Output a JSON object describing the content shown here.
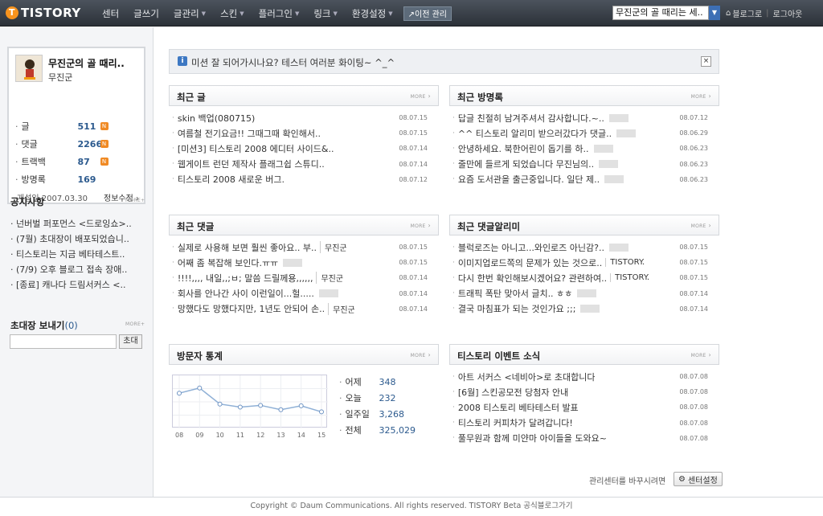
{
  "topbar": {
    "logo_text": "TISTORY",
    "logo_mark": "T",
    "menu": [
      {
        "label": "센터",
        "caret": ""
      },
      {
        "label": "글쓰기",
        "caret": ""
      },
      {
        "label": "글관리",
        "caret": "▼"
      },
      {
        "label": "스킨",
        "caret": "▼"
      },
      {
        "label": "플러그인",
        "caret": "▼"
      },
      {
        "label": "링크",
        "caret": "▼"
      },
      {
        "label": "환경설정",
        "caret": "▼"
      }
    ],
    "prev_admin": "↗이전 관리",
    "blog_select_value": "무진군의 골 때리는 세..",
    "blog_link": "블로그로",
    "logout": "로그아웃"
  },
  "sidebar": {
    "blog_name": "무진군의 골 때리..",
    "owner": "무진군",
    "stats": [
      {
        "label": "글",
        "value": "511",
        "new": "N"
      },
      {
        "label": "댓글",
        "value": "2266",
        "new": "N"
      },
      {
        "label": "트랙백",
        "value": "87",
        "new": "N"
      },
      {
        "label": "방명록",
        "value": "169",
        "new": ""
      }
    ],
    "opened": "개설일 2007.03.30",
    "edit_info": "정보수정 ›",
    "notice_title": "공지사항",
    "more": "MORE+",
    "notices": [
      "넌버벌 퍼포먼스 <드로잉쇼>..",
      "(7월) 초대장이 배포되었습니..",
      "티스토리는 지금 베타테스트..",
      "(7/9) 오후 블로그 접속 장애..",
      "[종료] 캐나다 드림서커스 <.."
    ],
    "invite_title": "초대장 보내기",
    "invite_count": "(0)",
    "invite_button": "초대"
  },
  "notice_bar": {
    "text": "미션 잘 되어가시나요? 테스터 여러분 화이팅~ ^_^",
    "close": "×"
  },
  "panels": {
    "recent_posts": {
      "title": "최근 글",
      "more": "MORE",
      "rows": [
        {
          "text": "skin 백업(080715)",
          "date": "08.07.15"
        },
        {
          "text": "여름철 전기요금!! 그때그때 확인해서..",
          "date": "08.07.15"
        },
        {
          "text": "[미션3] 티스토리 2008 에디터 사이드&..",
          "date": "08.07.14"
        },
        {
          "text": "웹게이트 런던 제작사 플래그쉽 스튜디..",
          "date": "08.07.14"
        },
        {
          "text": "티스토리 2008 새로운 버그.",
          "date": "08.07.12"
        }
      ]
    },
    "recent_guestbook": {
      "title": "최근 방명록",
      "more": "MORE",
      "rows": [
        {
          "text": "답글 친절히 남겨주셔서 감사합니다.~..",
          "date": "08.07.12"
        },
        {
          "text": "^^ 티스토리 알리미 받으러갔다가 댓글..",
          "date": "08.06.29"
        },
        {
          "text": "안녕하세요. 북한어린이 돕기를 하..",
          "date": "08.06.23"
        },
        {
          "text": "줄만에 들르게 되었습니다 무진님의..",
          "date": "08.06.23"
        },
        {
          "text": "요즘 도서관을 출근중입니다. 일단 제..",
          "date": "08.06.23"
        }
      ]
    },
    "recent_comments": {
      "title": "최근 댓글",
      "more": "MORE",
      "rows": [
        {
          "text": "실제로 사용해 보면 훨씬 좋아요.. 부..",
          "author": "무진군",
          "date": "08.07.15"
        },
        {
          "text": "어째 좀 복잡해 보인다.ㅠㅠ",
          "author": "",
          "date": "08.07.15"
        },
        {
          "text": "!!!!,,,, 내일,,;ㅂ; 말씀 드릴께용,,,,,,",
          "author": "무진군",
          "date": "08.07.14"
        },
        {
          "text": "회사를 안나간 사이 이런일이...헐.....",
          "author": "",
          "date": "08.07.14"
        },
        {
          "text": "망했다도 망했다지만, 1년도 안되어 손..",
          "author": "무진군",
          "date": "08.07.14"
        }
      ]
    },
    "comment_alarm": {
      "title": "최근 댓글알리미",
      "more": "MORE",
      "rows": [
        {
          "text": "블럭로즈는 아니고...와인로즈 아닌감?..",
          "author": "",
          "date": "08.07.15"
        },
        {
          "text": "이미지업로드쪽의 문제가 있는 것으로..",
          "author": "TISTORY.",
          "date": "08.07.15"
        },
        {
          "text": "다시 한번 확인해보시겠어요? 관련하여..",
          "author": "TISTORY.",
          "date": "08.07.15"
        },
        {
          "text": "트래픽 폭탄 맞아서 글치.. ㅎㅎ",
          "author": "",
          "date": "08.07.14"
        },
        {
          "text": "결국 마침표가 되는 것인가요 ;;;",
          "author": "",
          "date": "08.07.14"
        }
      ]
    },
    "visitor_stats": {
      "title": "방문자 통계",
      "more": "MORE",
      "days": [
        "08",
        "09",
        "10",
        "11",
        "12",
        "13",
        "14",
        "15"
      ],
      "graph": [
        0.7,
        0.82,
        0.45,
        0.38,
        0.42,
        0.32,
        0.41,
        0.27
      ],
      "stats": [
        {
          "label": "어제",
          "value": "348"
        },
        {
          "label": "오늘",
          "value": "232"
        },
        {
          "label": "일주일",
          "value": "3,268"
        },
        {
          "label": "전체",
          "value": "325,029"
        }
      ]
    },
    "tistory_events": {
      "title": "티스토리 이벤트 소식",
      "more": "MORE",
      "rows": [
        {
          "text": "아트 서커스 <네비아>로 초대합니다",
          "date": "08.07.08"
        },
        {
          "text": "[6월] 스킨공모전 당첨자 안내",
          "date": "08.07.08"
        },
        {
          "text": "2008 티스토리 베타테스터 발표",
          "date": "08.07.08"
        },
        {
          "text": "티스토리 커피차가 달려갑니다!",
          "date": "08.07.08"
        },
        {
          "text": "풀무원과 함께 미얀마 아이들을 도와요~",
          "date": "08.07.08"
        }
      ]
    }
  },
  "admin_switch": "관리센터를 바꾸시려면",
  "center_settings": "센터설정",
  "footer": "Copyright © Daum Communications. All rights reserved. TISTORY Beta 공식블로그가기"
}
